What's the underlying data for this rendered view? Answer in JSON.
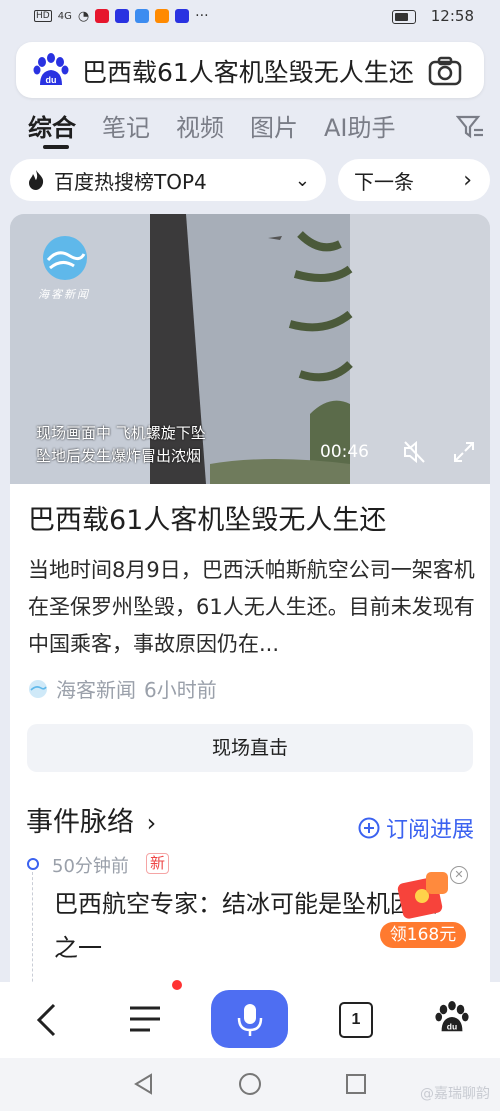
{
  "status_bar": {
    "hd": "HD",
    "signal": "4G",
    "time": "12:58"
  },
  "search": {
    "query": "巴西载61人客机坠毁无人生还"
  },
  "tabs": [
    "综合",
    "笔记",
    "视频",
    "图片",
    "AI助手"
  ],
  "hot": {
    "rank_label": "百度热搜榜TOP4",
    "next_label": "下一条"
  },
  "video": {
    "logo_text": "海客新闻",
    "caption_line1": "现场画面中 飞机螺旋下坠",
    "caption_line2": "坠地后发生爆炸冒出浓烟",
    "duration": "00:46"
  },
  "article": {
    "headline": "巴西载61人客机坠毁无人生还",
    "summary": "当地时间8月9日，巴西沃帕斯航空公司一架客机在圣保罗州坠毁，61人无人生还。目前未发现有中国乘客，事故原因仍在...",
    "source": "海客新闻",
    "time_ago": "6小时前",
    "live_button": "现场直击"
  },
  "timeline": {
    "title": "事件脉络",
    "subscribe": "订阅进展",
    "item_time": "50分钟前",
    "item_badge": "新",
    "item_text": "巴西航空专家：结冰可能是坠机因素之一"
  },
  "promo": {
    "label": "领168元"
  },
  "bottom_nav": {
    "tab_count": "1"
  },
  "watermark": "@嘉瑞聊韵",
  "colors": {
    "accent": "#4e6ef2",
    "link": "#3b62f0",
    "promo": "#ff7a2f"
  }
}
